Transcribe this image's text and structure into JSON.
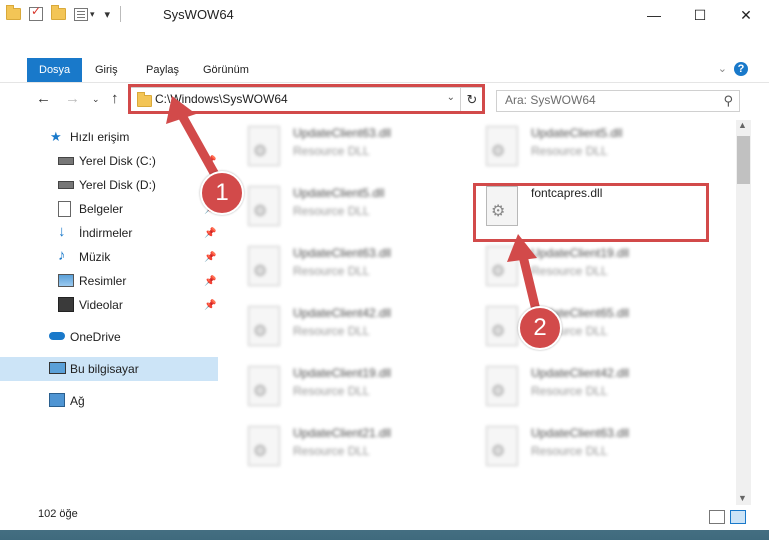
{
  "window": {
    "title": "SysWOW64",
    "controls": {
      "minimize": "—",
      "maximize": "☐",
      "close": "✕"
    }
  },
  "ribbon": {
    "tabs": [
      {
        "label": "Dosya",
        "active": true
      },
      {
        "label": "Giriş",
        "active": false
      },
      {
        "label": "Paylaş",
        "active": false
      },
      {
        "label": "Görünüm",
        "active": false
      }
    ],
    "help": "?"
  },
  "address": {
    "path": "C:\\Windows\\SysWOW64",
    "search_placeholder": "Ara: SysWOW64"
  },
  "sidebar": {
    "items": [
      {
        "label": "Hızlı erişim",
        "icon": "star-icon",
        "pinned": false
      },
      {
        "label": "Yerel Disk (C:)",
        "icon": "drive-icon",
        "pinned": true
      },
      {
        "label": "Yerel Disk (D:)",
        "icon": "drive-icon",
        "pinned": true
      },
      {
        "label": "Belgeler",
        "icon": "documents-icon",
        "pinned": true
      },
      {
        "label": "İndirmeler",
        "icon": "download-icon",
        "pinned": true
      },
      {
        "label": "Müzik",
        "icon": "music-icon",
        "pinned": true
      },
      {
        "label": "Resimler",
        "icon": "pictures-icon",
        "pinned": true
      },
      {
        "label": "Videolar",
        "icon": "videos-icon",
        "pinned": true
      },
      {
        "label": "OneDrive",
        "icon": "cloud-icon",
        "pinned": false
      },
      {
        "label": "Bu bilgisayar",
        "icon": "computer-icon",
        "pinned": false,
        "selected": true
      },
      {
        "label": "Ağ",
        "icon": "network-icon",
        "pinned": false
      }
    ]
  },
  "files": [
    {
      "name": "UpdateClient63.dll",
      "type": "Resource DLL"
    },
    {
      "name": "UpdateClient5.dll",
      "type": "Resource DLL"
    },
    {
      "name": "UpdateClient5.dll",
      "type": "Resource DLL"
    },
    {
      "name": "fontcapres.dll",
      "type": ""
    },
    {
      "name": "UpdateClient63.dll",
      "type": "Resource DLL"
    },
    {
      "name": "UpdateClient19.dll",
      "type": "Resource DLL"
    },
    {
      "name": "UpdateClient42.dll",
      "type": "Resource DLL"
    },
    {
      "name": "UpdateClient65.dll",
      "type": "Resource DLL"
    },
    {
      "name": "UpdateClient19.dll",
      "type": "Resource DLL"
    },
    {
      "name": "UpdateClient42.dll",
      "type": "Resource DLL"
    },
    {
      "name": "UpdateClient21.dll",
      "type": "Resource DLL"
    },
    {
      "name": "UpdateClient63.dll",
      "type": "Resource DLL"
    }
  ],
  "status": {
    "item_count": "102 öğe"
  },
  "annotations": {
    "badge1": "1",
    "badge2": "2",
    "color": "#d24a4a"
  }
}
